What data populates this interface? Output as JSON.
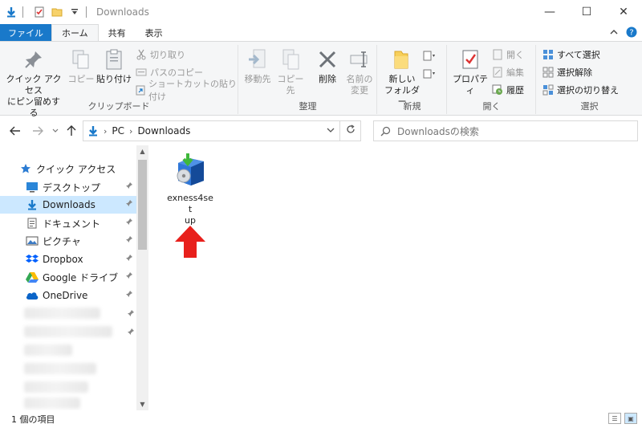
{
  "window": {
    "title": "Downloads",
    "controls": {
      "minimize": "—",
      "maximize": "☐",
      "close": "✕"
    }
  },
  "ribbon_tabs": {
    "file": "ファイル",
    "home": "ホーム",
    "share": "共有",
    "view": "表示"
  },
  "ribbon": {
    "clipboard": {
      "label": "クリップボード",
      "pin_quick_access": "クイック アクセス\nにピン留めする",
      "copy": "コピー",
      "paste": "貼り付け",
      "cut": "切り取り",
      "copy_path": "パスのコピー",
      "paste_shortcut": "ショートカットの貼り付け"
    },
    "organize": {
      "label": "整理",
      "move_to": "移動先",
      "copy_to": "コピー先",
      "delete": "削除",
      "rename": "名前の\n変更"
    },
    "new": {
      "label": "新規",
      "new_folder": "新しい\nフォルダー"
    },
    "open": {
      "label": "開く",
      "properties": "プロパティ",
      "open": "開く",
      "edit": "編集",
      "history": "履歴"
    },
    "select": {
      "label": "選択",
      "select_all": "すべて選択",
      "select_none": "選択解除",
      "invert_selection": "選択の切り替え"
    }
  },
  "address": {
    "path": [
      "PC",
      "Downloads"
    ],
    "search_placeholder": "Downloadsの検索"
  },
  "nav_pane": {
    "items": [
      {
        "label": "クイック アクセス",
        "icon": "star-icon"
      },
      {
        "label": "デスクトップ",
        "icon": "desktop-icon",
        "pinned": true
      },
      {
        "label": "Downloads",
        "icon": "download-arrow-icon",
        "pinned": true,
        "selected": true
      },
      {
        "label": "ドキュメント",
        "icon": "document-icon",
        "pinned": true
      },
      {
        "label": "ピクチャ",
        "icon": "pictures-icon",
        "pinned": true
      },
      {
        "label": "Dropbox",
        "icon": "dropbox-icon",
        "pinned": true
      },
      {
        "label": "Google ドライブ",
        "icon": "google-drive-icon",
        "pinned": true
      },
      {
        "label": "OneDrive",
        "icon": "onedrive-icon",
        "pinned": true
      }
    ],
    "pin_glyph": "📌"
  },
  "files": [
    {
      "name": "exness4setup",
      "display": "exness4set\nup",
      "icon": "installer-box-icon"
    }
  ],
  "status": {
    "item_count": "1 個の項目"
  },
  "colors": {
    "accent": "#1979ca",
    "selected_bg": "#cce8ff",
    "arrow_red": "#e8201c"
  }
}
